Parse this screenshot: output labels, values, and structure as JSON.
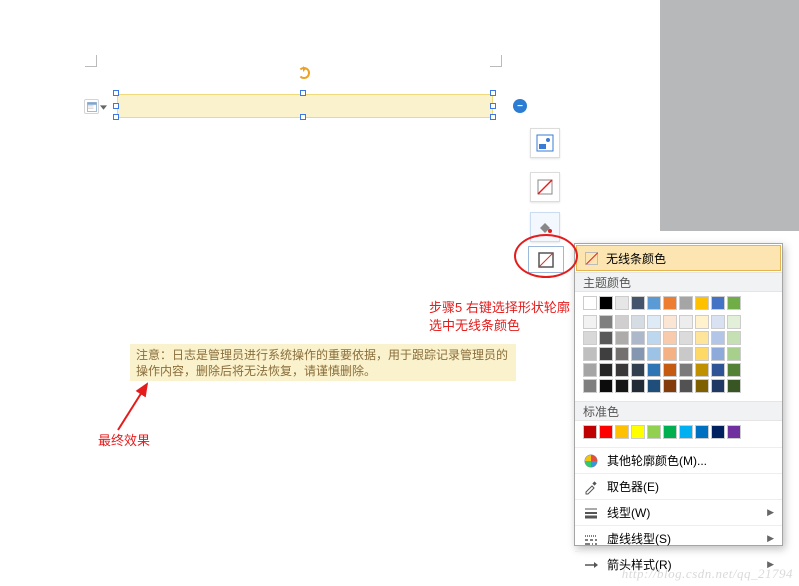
{
  "annotations": {
    "step5_line1": "步骤5 右键选择形状轮廓",
    "step5_line2": "选中无线条颜色",
    "final_effect": "最终效果"
  },
  "result_box": {
    "text": "注意：日志是管理员进行系统操作的重要依据，用于跟踪记录管理员的操作内容，删除后将无法恢复，请谨慎删除。"
  },
  "popup": {
    "no_outline": "无线条颜色",
    "theme_header": "主题颜色",
    "standard_header": "标准色",
    "more_colors": "其他轮廓颜色(M)...",
    "eyedropper": "取色器(E)",
    "weight": "线型(W)",
    "dashes": "虚线线型(S)",
    "arrows": "箭头样式(R)",
    "theme_row1": [
      "#ffffff",
      "#000000",
      "#e7e6e6",
      "#44546a",
      "#5b9bd5",
      "#ed7d31",
      "#a5a5a5",
      "#ffc000",
      "#4472c4",
      "#70ad47"
    ],
    "theme_shades": [
      [
        "#f2f2f2",
        "#7f7f7f",
        "#d0cece",
        "#d6dce4",
        "#deebf6",
        "#fbe5d5",
        "#ededed",
        "#fff2cc",
        "#d9e2f3",
        "#e2efd9"
      ],
      [
        "#d8d8d8",
        "#595959",
        "#aeabab",
        "#adb9ca",
        "#bdd7ee",
        "#f7cbac",
        "#dbdbdb",
        "#fee599",
        "#b4c6e7",
        "#c5e0b3"
      ],
      [
        "#bfbfbf",
        "#3f3f3f",
        "#757070",
        "#8496b0",
        "#9cc3e5",
        "#f4b183",
        "#c9c9c9",
        "#ffd965",
        "#8eaadb",
        "#a8d08d"
      ],
      [
        "#a5a5a5",
        "#262626",
        "#3a3838",
        "#323f4f",
        "#2e75b5",
        "#c55a11",
        "#7b7b7b",
        "#bf9000",
        "#2f5496",
        "#538135"
      ],
      [
        "#7f7f7f",
        "#0c0c0c",
        "#171616",
        "#222a35",
        "#1e4e79",
        "#833c0b",
        "#525252",
        "#7f6000",
        "#1f3864",
        "#375623"
      ]
    ],
    "standard_colors": [
      "#c00000",
      "#ff0000",
      "#ffc000",
      "#ffff00",
      "#92d050",
      "#00b050",
      "#00b0f0",
      "#0070c0",
      "#002060",
      "#7030a0"
    ]
  },
  "watermark": "http://blog.csdn.net/qq_21794"
}
